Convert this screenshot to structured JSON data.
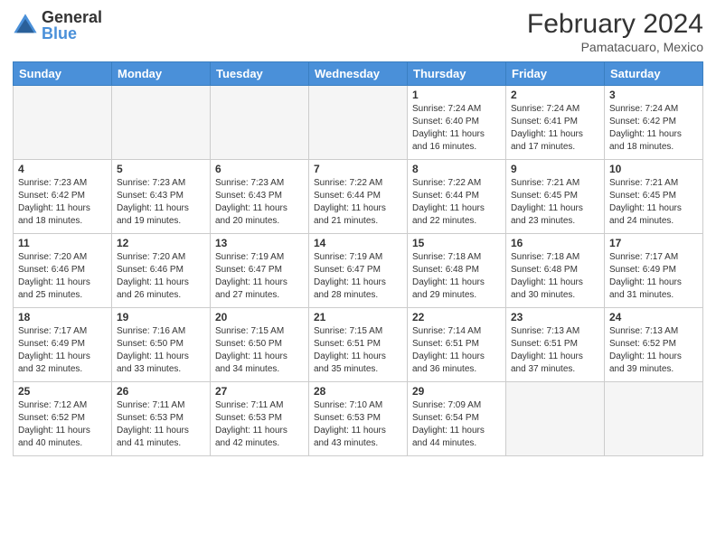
{
  "header": {
    "logo_general": "General",
    "logo_blue": "Blue",
    "month_title": "February 2024",
    "subtitle": "Pamatacuaro, Mexico"
  },
  "calendar": {
    "days_of_week": [
      "Sunday",
      "Monday",
      "Tuesday",
      "Wednesday",
      "Thursday",
      "Friday",
      "Saturday"
    ],
    "weeks": [
      [
        {
          "day": "",
          "empty": true
        },
        {
          "day": "",
          "empty": true
        },
        {
          "day": "",
          "empty": true
        },
        {
          "day": "",
          "empty": true
        },
        {
          "day": "1",
          "sunrise": "7:24 AM",
          "sunset": "6:40 PM",
          "daylight": "11 hours and 16 minutes."
        },
        {
          "day": "2",
          "sunrise": "7:24 AM",
          "sunset": "6:41 PM",
          "daylight": "11 hours and 17 minutes."
        },
        {
          "day": "3",
          "sunrise": "7:24 AM",
          "sunset": "6:42 PM",
          "daylight": "11 hours and 18 minutes."
        }
      ],
      [
        {
          "day": "4",
          "sunrise": "7:23 AM",
          "sunset": "6:42 PM",
          "daylight": "11 hours and 18 minutes."
        },
        {
          "day": "5",
          "sunrise": "7:23 AM",
          "sunset": "6:43 PM",
          "daylight": "11 hours and 19 minutes."
        },
        {
          "day": "6",
          "sunrise": "7:23 AM",
          "sunset": "6:43 PM",
          "daylight": "11 hours and 20 minutes."
        },
        {
          "day": "7",
          "sunrise": "7:22 AM",
          "sunset": "6:44 PM",
          "daylight": "11 hours and 21 minutes."
        },
        {
          "day": "8",
          "sunrise": "7:22 AM",
          "sunset": "6:44 PM",
          "daylight": "11 hours and 22 minutes."
        },
        {
          "day": "9",
          "sunrise": "7:21 AM",
          "sunset": "6:45 PM",
          "daylight": "11 hours and 23 minutes."
        },
        {
          "day": "10",
          "sunrise": "7:21 AM",
          "sunset": "6:45 PM",
          "daylight": "11 hours and 24 minutes."
        }
      ],
      [
        {
          "day": "11",
          "sunrise": "7:20 AM",
          "sunset": "6:46 PM",
          "daylight": "11 hours and 25 minutes."
        },
        {
          "day": "12",
          "sunrise": "7:20 AM",
          "sunset": "6:46 PM",
          "daylight": "11 hours and 26 minutes."
        },
        {
          "day": "13",
          "sunrise": "7:19 AM",
          "sunset": "6:47 PM",
          "daylight": "11 hours and 27 minutes."
        },
        {
          "day": "14",
          "sunrise": "7:19 AM",
          "sunset": "6:47 PM",
          "daylight": "11 hours and 28 minutes."
        },
        {
          "day": "15",
          "sunrise": "7:18 AM",
          "sunset": "6:48 PM",
          "daylight": "11 hours and 29 minutes."
        },
        {
          "day": "16",
          "sunrise": "7:18 AM",
          "sunset": "6:48 PM",
          "daylight": "11 hours and 30 minutes."
        },
        {
          "day": "17",
          "sunrise": "7:17 AM",
          "sunset": "6:49 PM",
          "daylight": "11 hours and 31 minutes."
        }
      ],
      [
        {
          "day": "18",
          "sunrise": "7:17 AM",
          "sunset": "6:49 PM",
          "daylight": "11 hours and 32 minutes."
        },
        {
          "day": "19",
          "sunrise": "7:16 AM",
          "sunset": "6:50 PM",
          "daylight": "11 hours and 33 minutes."
        },
        {
          "day": "20",
          "sunrise": "7:15 AM",
          "sunset": "6:50 PM",
          "daylight": "11 hours and 34 minutes."
        },
        {
          "day": "21",
          "sunrise": "7:15 AM",
          "sunset": "6:51 PM",
          "daylight": "11 hours and 35 minutes."
        },
        {
          "day": "22",
          "sunrise": "7:14 AM",
          "sunset": "6:51 PM",
          "daylight": "11 hours and 36 minutes."
        },
        {
          "day": "23",
          "sunrise": "7:13 AM",
          "sunset": "6:51 PM",
          "daylight": "11 hours and 37 minutes."
        },
        {
          "day": "24",
          "sunrise": "7:13 AM",
          "sunset": "6:52 PM",
          "daylight": "11 hours and 39 minutes."
        }
      ],
      [
        {
          "day": "25",
          "sunrise": "7:12 AM",
          "sunset": "6:52 PM",
          "daylight": "11 hours and 40 minutes."
        },
        {
          "day": "26",
          "sunrise": "7:11 AM",
          "sunset": "6:53 PM",
          "daylight": "11 hours and 41 minutes."
        },
        {
          "day": "27",
          "sunrise": "7:11 AM",
          "sunset": "6:53 PM",
          "daylight": "11 hours and 42 minutes."
        },
        {
          "day": "28",
          "sunrise": "7:10 AM",
          "sunset": "6:53 PM",
          "daylight": "11 hours and 43 minutes."
        },
        {
          "day": "29",
          "sunrise": "7:09 AM",
          "sunset": "6:54 PM",
          "daylight": "11 hours and 44 minutes."
        },
        {
          "day": "",
          "empty": true
        },
        {
          "day": "",
          "empty": true
        }
      ]
    ]
  }
}
